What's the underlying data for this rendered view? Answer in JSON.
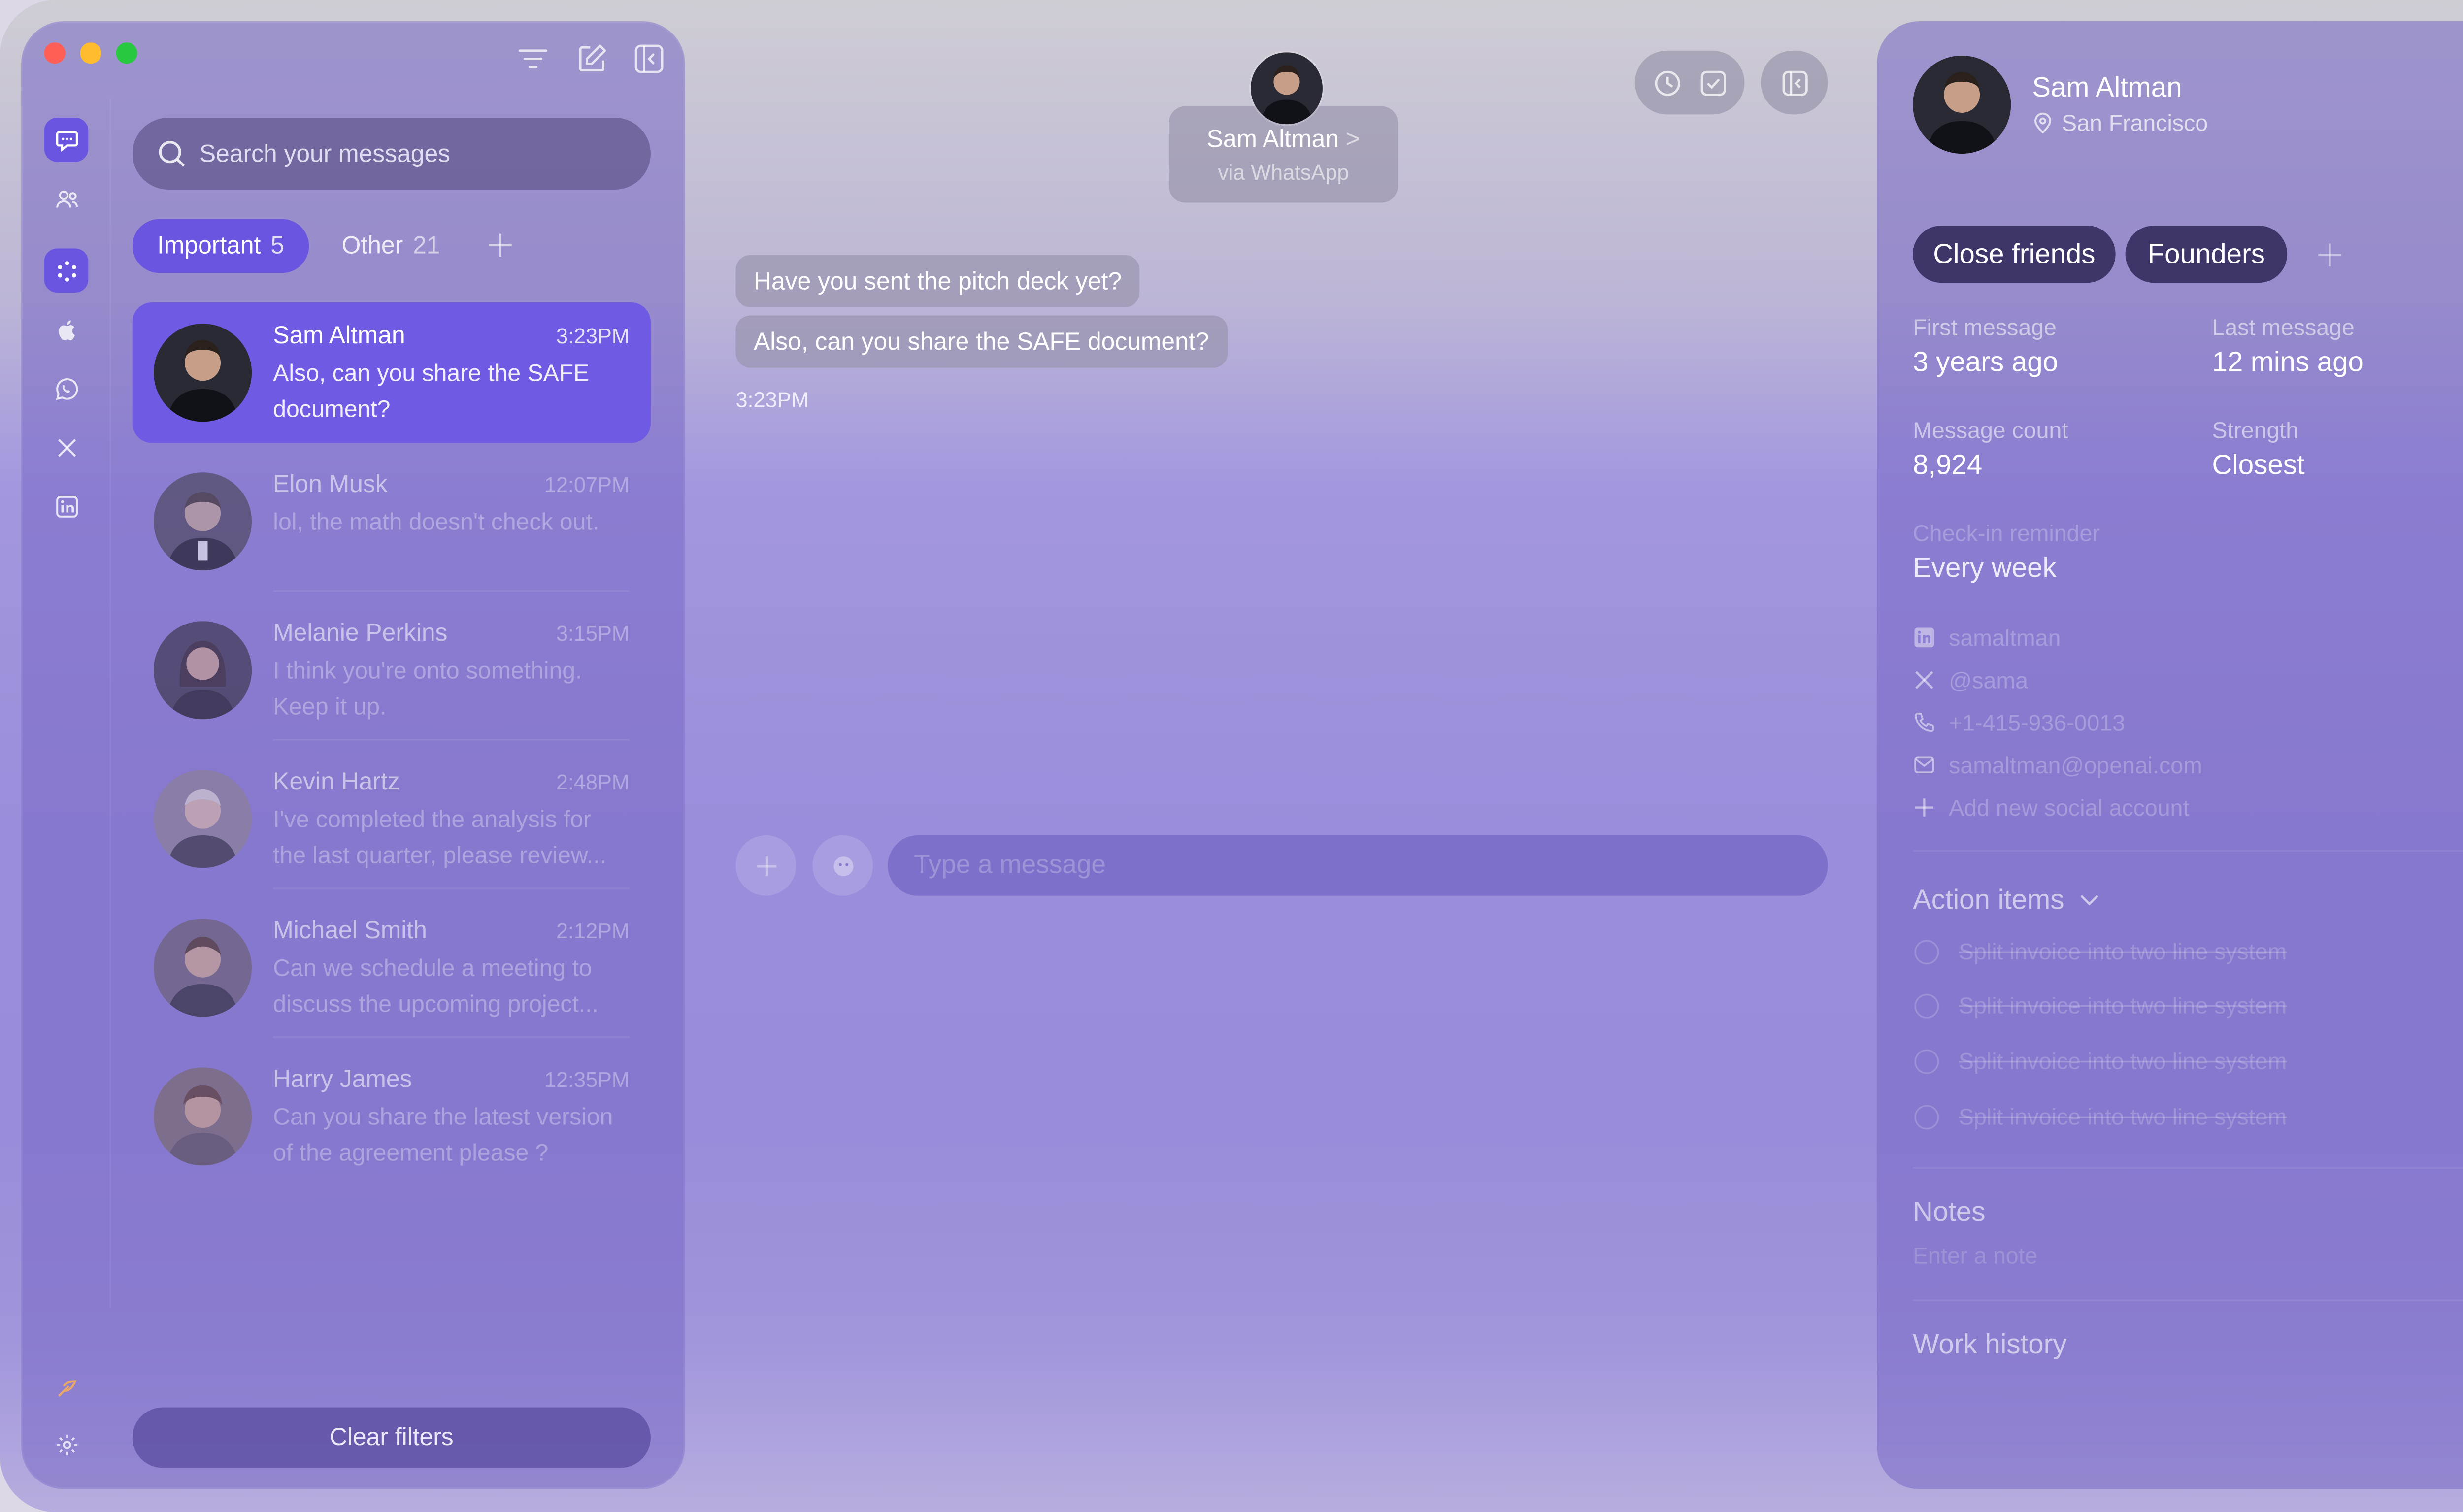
{
  "sidebar_left": {
    "search": {
      "placeholder": "Search  your messages"
    },
    "filters": {
      "important": {
        "label": "Important",
        "count": "5"
      },
      "other": {
        "label": "Other",
        "count": "21"
      }
    },
    "conversations": [
      {
        "name": "Sam Altman",
        "time": "3:23PM",
        "preview": "Also, can you share the SAFE document?",
        "avatar_color": "#2a2a35"
      },
      {
        "name": "Elon Musk",
        "time": "12:07PM",
        "preview": "lol, the math doesn't check out.",
        "avatar_color": "#4a4658"
      },
      {
        "name": "Melanie Perkins",
        "time": "3:15PM",
        "preview": "I think you're onto something. Keep it up.",
        "avatar_color": "#3a3548"
      },
      {
        "name": "Kevin Hartz",
        "time": "2:48PM",
        "preview": "I've completed the analysis for the last quarter, please review...",
        "avatar_color": "#8c8294"
      },
      {
        "name": "Michael Smith",
        "time": "2:12PM",
        "preview": "Can we schedule a meeting to discuss the upcoming project...",
        "avatar_color": "#6a5e72"
      },
      {
        "name": "Harry James",
        "time": "12:35PM",
        "preview": "Can you share the latest version of the agreement please ?",
        "avatar_color": "#7a6a6a"
      }
    ],
    "clear_filters": "Clear filters"
  },
  "chat": {
    "contact_name": "Sam Altman",
    "chevron": ">",
    "via": "via WhatsApp",
    "messages": [
      {
        "text": "Have you sent the pitch deck yet?"
      },
      {
        "text": "Also, can you share the SAFE document?"
      }
    ],
    "timestamp": "3:23PM",
    "composer_placeholder": "Type a message"
  },
  "profile": {
    "name": "Sam Altman",
    "location": "San Francisco",
    "tags": [
      "Close friends",
      "Founders"
    ],
    "stats": {
      "first_message_label": "First message",
      "first_message_value": "3 years ago",
      "last_message_label": "Last message",
      "last_message_value": "12 mins ago",
      "message_count_label": "Message count",
      "message_count_value": "8,924",
      "strength_label": "Strength",
      "strength_value": "Closest"
    },
    "checkin": {
      "label": "Check-in reminder",
      "value": "Every week"
    },
    "socials": {
      "linkedin": "samaltman",
      "x": "@sama",
      "phone": "+1-415-936-0013",
      "email": "samaltman@openai.com",
      "add": "Add new social account"
    },
    "action_items": {
      "title": "Action items",
      "items": [
        "Split invoice into two line system",
        "Split invoice into two line system",
        "Split invoice into two line system",
        "Split invoice into two line system"
      ]
    },
    "notes": {
      "title": "Notes",
      "placeholder": "Enter a note"
    },
    "work_history": {
      "title": "Work history"
    }
  },
  "colors": {
    "accent": "#6a55e0",
    "traffic_red": "#ff5f57",
    "traffic_yellow": "#febc2e",
    "traffic_green": "#28c840",
    "tag_bg": "#3e3568"
  },
  "icons": {
    "rail": [
      "chat-icon",
      "contacts-icon",
      "loader-icon",
      "apple-icon",
      "whatsapp-icon",
      "x-icon",
      "linkedin-icon",
      "feather-icon",
      "settings-icon"
    ],
    "toolbar": [
      "filter-icon",
      "compose-icon",
      "collapse-sidebar-icon"
    ]
  }
}
